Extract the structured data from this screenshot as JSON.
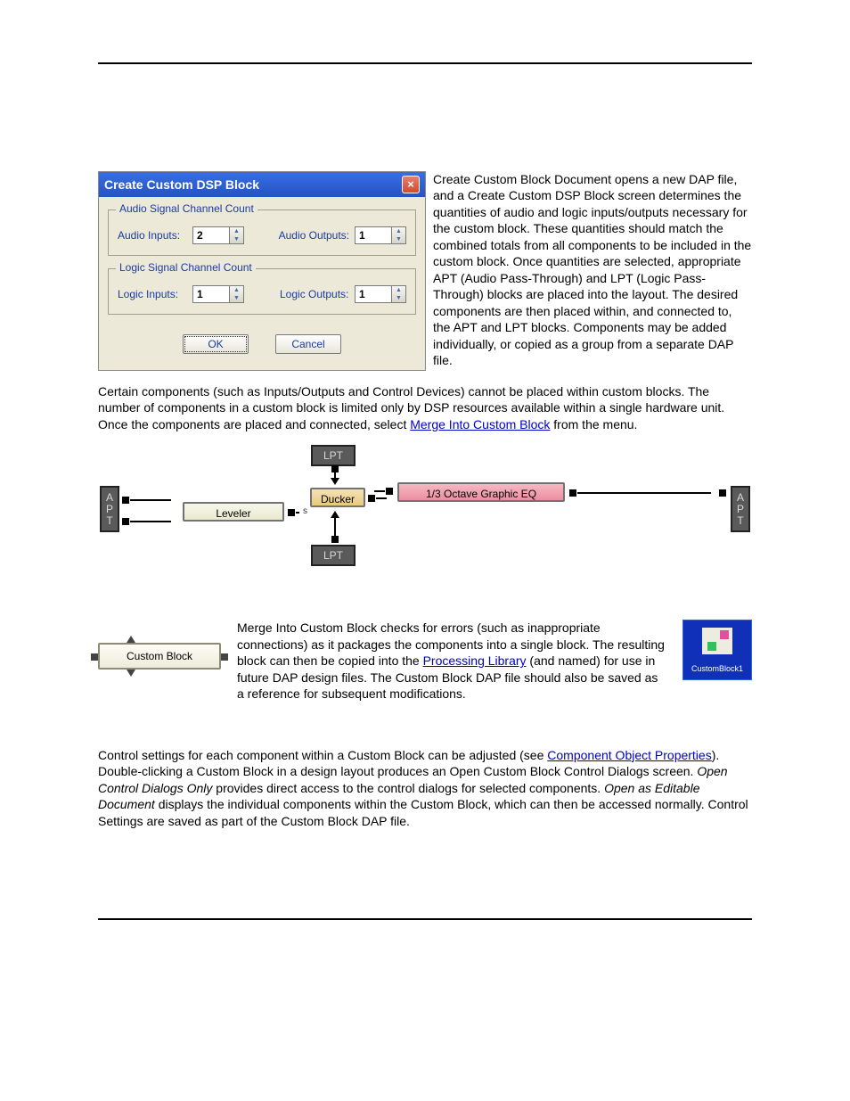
{
  "dialog": {
    "title": "Create Custom DSP Block",
    "group_audio": {
      "legend": "Audio Signal Channel Count",
      "inputs_label": "Audio Inputs:",
      "inputs_value": "2",
      "outputs_label": "Audio Outputs:",
      "outputs_value": "1"
    },
    "group_logic": {
      "legend": "Logic Signal Channel Count",
      "inputs_label": "Logic Inputs:",
      "inputs_value": "1",
      "outputs_label": "Logic Outputs:",
      "outputs_value": "1"
    },
    "ok": "OK",
    "cancel": "Cancel"
  },
  "para_right": "Create Custom Block Document opens a new DAP file, and a Create Custom DSP Block screen determines the quantities of audio and logic inputs/outputs necessary for the custom block. These quantities should match the combined totals from all components to be included in the custom block. Once quantities are selected, appropriate APT (Audio Pass-Through) and LPT (Logic Pass-Through) blocks are placed into the layout. The desired components are then placed within, and connected to, the APT and LPT blocks. Components may be added individually, or copied as a group from a separate DAP file.",
  "para2_a": "Certain components (such as Inputs/Outputs and Control Devices) cannot be placed within custom blocks. The number of components in a custom block is limited only by DSP resources available within a single hardware unit. Once the components are placed and connected, select ",
  "para2_link": "Merge Into Custom Block",
  "para2_b": " from the menu.",
  "diagram": {
    "lpt": "LPT",
    "apt_chars": [
      "A",
      "P",
      "T"
    ],
    "leveler": "Leveler",
    "ducker": "Ducker",
    "eq": "1/3 Octave Graphic EQ"
  },
  "custom_block_label": "Custom Block",
  "para3_a": "Merge Into Custom Block checks for errors (such as inappropriate connections) as it packages the components into a single block. The resulting block can then be copied into the ",
  "para3_link": "Processing Library",
  "para3_b": " (and named) for use in future DAP design files. The Custom Block DAP file should also be saved as a reference for subsequent modifications.",
  "catalog_caption": "CustomBlock1",
  "para4_a": "Control settings for each component within a Custom Block can be adjusted (see ",
  "para4_link1": "Component Object Properties",
  "para4_b": "). Double-clicking a Custom Block in a design layout produces an Open Custom Block Control Dialogs screen. ",
  "para4_i1": "Open Control Dialogs Only",
  "para4_c": " provides direct access to the control dialogs for selected components. ",
  "para4_i2": "Open as Editable Document",
  "para4_d": " displays the individual components within the Custom Block, which can then be accessed normally. Control Settings are saved as part of the Custom Block DAP file."
}
